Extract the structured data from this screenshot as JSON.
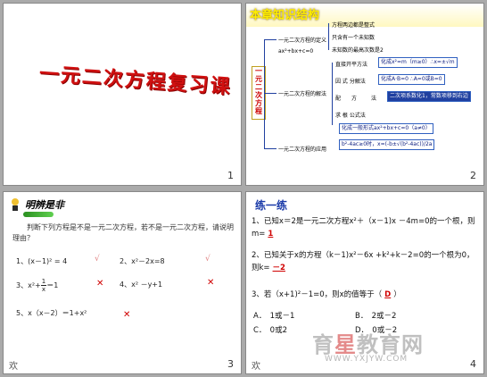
{
  "slide1": {
    "title": "一元二次方程复习课",
    "page_num": "1"
  },
  "slide2": {
    "header": "本章知识结构",
    "vbar": "一元二次方程",
    "n1": "一元二次方程的定义",
    "n1_sub": "ax²+bx+c=0",
    "n2": "一元二次方程的解法",
    "n3": "一元二次方程的应用",
    "d1": "方程两边都是整式",
    "d2": "只含有一个未知数",
    "d3": "未知数的最高次数是2",
    "m1": "直接开平方法",
    "m1_box": "化成x²=m（m≥0）∴x=±√m",
    "m2": "因 式 分解法",
    "m2_box": "化成A·B=0 ∴A=0或B=0",
    "m3a": "配",
    "m3b": "方",
    "m3c": "法",
    "m3_box": "二次项系数化1，常数项移到右边",
    "m4": "求 根 公式法",
    "m4_box": "化成一般形式ax²+bx+c=0（a≠0）",
    "m5_box": "b²-4ac≥0时，x=(-b±√(b²-4ac))/2a",
    "page_num": "2"
  },
  "slide3": {
    "title": "明辨是非",
    "intro": "　　判断下列方程是不是一元二次方程，若不是一元二次方程，请说明理由？",
    "items": [
      "1、(x－1)² = 4",
      "2、x²－2x=8",
      "3、x²+",
      "＝1",
      "4、x² －y+1",
      "5、x（x－2）＝1+x²"
    ],
    "frac_num": "1",
    "frac_den": "x",
    "ok": "√",
    "x": "✕",
    "page_num": "3",
    "corner": "欢"
  },
  "slide4": {
    "title": "练一练",
    "q1a": "1、已知x＝2是一元二次方程x²＋（x－1)x －4m=0的一个根，则m=",
    "q1_ans": "1",
    "q2a": "2、已知关于x的方程（k－1)x²－6x +k²+k－2=0的一个根为0，则k=",
    "q2_ans": "－2",
    "q3a": "3、若（x+1)²－1=0，则x的值等于（",
    "q3_ans": "D",
    "q3b": "）",
    "optA": "A．　1或－1",
    "optB": "B．　2或－2",
    "optC": "C．　0或2",
    "optD": "D．　0或－2",
    "page_num": "4",
    "corner": "欢"
  },
  "watermark": {
    "a": "育",
    "b": "星",
    "c": "教育网",
    "url": "WWW.YXJYW.COM"
  }
}
